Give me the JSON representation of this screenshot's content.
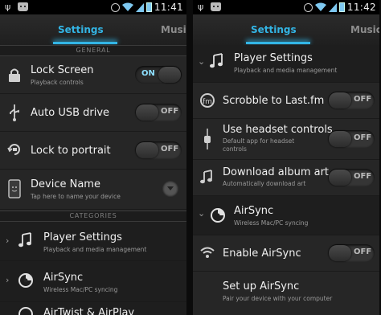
{
  "status_bar": {
    "left": {
      "time": "11:41"
    },
    "right": {
      "time": "11:42"
    }
  },
  "left": {
    "tab_active": "Settings",
    "tab_next": "Music",
    "section_general": "GENERAL",
    "lock_screen": {
      "title": "Lock Screen",
      "subtitle": "Playback controls",
      "toggle": "ON"
    },
    "auto_usb": {
      "title": "Auto USB drive",
      "toggle": "OFF"
    },
    "lock_portrait": {
      "title": "Lock to portrait",
      "toggle": "OFF"
    },
    "device_name": {
      "title": "Device Name",
      "subtitle": "Tap here to name your device"
    },
    "section_categories": "CATEGORIES",
    "player_settings": {
      "title": "Player Settings",
      "subtitle": "Playback and media management"
    },
    "airsync": {
      "title": "AirSync",
      "subtitle": "Wireless Mac/PC syncing"
    },
    "partial_row": {
      "title": "AirTwist & AirPlay"
    }
  },
  "right": {
    "tab_active": "Settings",
    "tab_next": "Music",
    "player_settings": {
      "title": "Player Settings",
      "subtitle": "Playback and media management"
    },
    "scrobble": {
      "title": "Scrobble to Last.fm",
      "toggle": "OFF"
    },
    "headset": {
      "title": "Use headset controls",
      "subtitle_line1": "Default app for headset",
      "subtitle_line2": "controls",
      "toggle": "OFF"
    },
    "download_art": {
      "title": "Download album art",
      "subtitle": "Automatically download art",
      "toggle": "OFF"
    },
    "airsync": {
      "title": "AirSync",
      "subtitle": "Wireless Mac/PC syncing"
    },
    "enable_airsync": {
      "title": "Enable AirSync",
      "toggle": "OFF"
    },
    "setup_airsync": {
      "title": "Set up AirSync",
      "subtitle": "Pair your device with your computer"
    }
  },
  "colors": {
    "accent": "#33b5e5",
    "background": "#262626",
    "section_header": "#1c1c1c"
  }
}
